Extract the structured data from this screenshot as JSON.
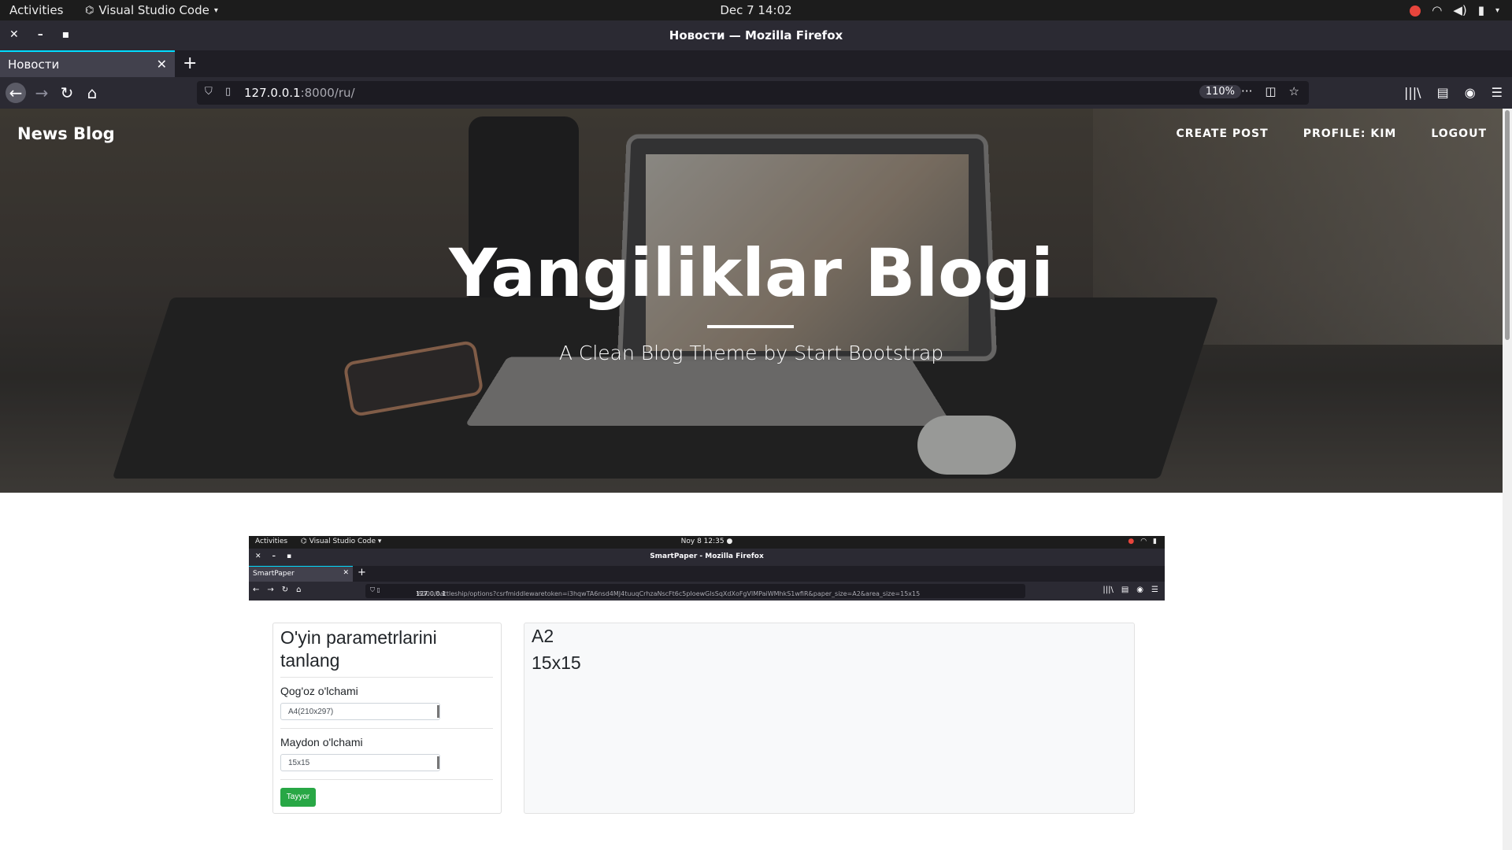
{
  "system": {
    "activities": "Activities",
    "app_name": "Visual Studio Code",
    "clock": "Dec 7  14:02"
  },
  "window": {
    "title": "Новости — Mozilla Firefox"
  },
  "tab": {
    "label": "Новости"
  },
  "urlbar": {
    "host": "127.0.0.1",
    "path": ":8000/ru/",
    "zoom": "110%"
  },
  "site": {
    "brand": "News Blog",
    "nav": [
      "CREATE POST",
      "PROFILE: KIM",
      "LOGOUT"
    ],
    "heading": "Yangiliklar Blogi",
    "subheading": "A Clean Blog Theme by Start Bootstrap"
  },
  "embedded": {
    "system": {
      "activities": "Activities",
      "app_name": "Visual Studio Code",
      "clock": "Noy 8  12:35"
    },
    "window_title": "SmartPaper - Mozilla Firefox",
    "tab_label": "SmartPaper",
    "url_host": "127.0.0.1",
    "url_rest": ":8000/battleship/options?csrfmiddlewaretoken=i3hqwTA6nsd4MJ4tuuqCrhzaNscFt6c5pIoewGlsSqXdXoFgVlMPaiWMhkS1wfiR&paper_size=A2&area_size=15x15",
    "form": {
      "title": "O'yin parametrlarini tanlang",
      "paper_label": "Qog'oz o'lchami",
      "paper_value": "A4(210x297)",
      "area_label": "Maydon o'lchami",
      "area_value": "15x15",
      "submit_label": "Tayyor"
    },
    "result": {
      "paper_size": "A2",
      "area_size": "15x15"
    }
  },
  "colors": {
    "accent_tab": "#00ddff",
    "submit_button": "#28a745"
  },
  "icons": [
    "close-icon",
    "minimize-icon",
    "maximize-icon",
    "back-icon",
    "forward-icon",
    "reload-icon",
    "home-icon",
    "shield-icon",
    "page-icon",
    "more-icon",
    "pocket-icon",
    "bookmark-star-icon",
    "library-icon",
    "sidebar-icon",
    "account-icon",
    "menu-icon",
    "wifi-icon",
    "volume-icon",
    "battery-icon"
  ]
}
